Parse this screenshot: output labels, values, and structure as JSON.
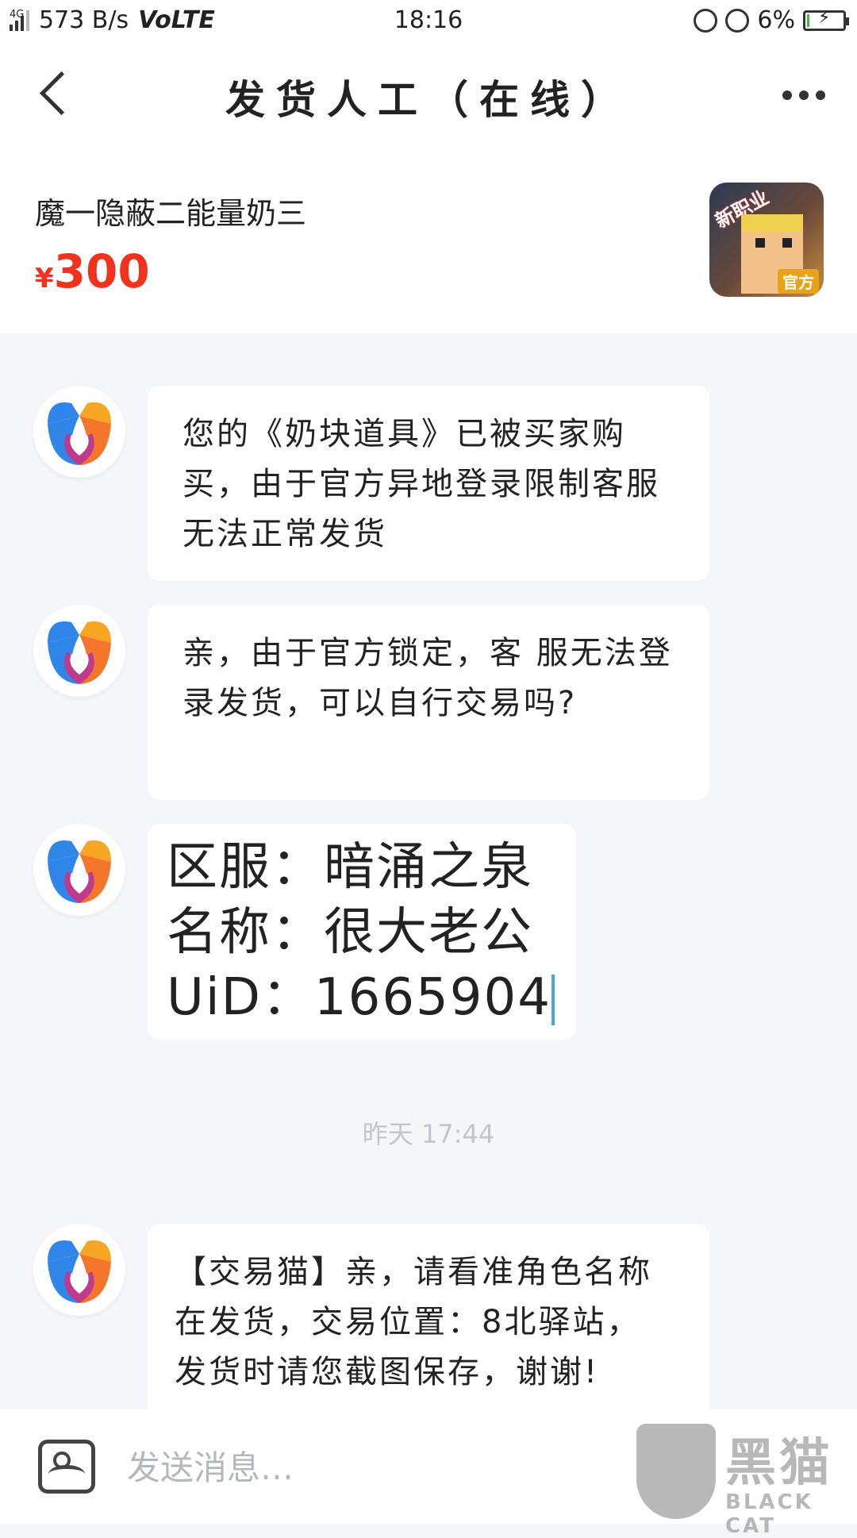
{
  "status_bar": {
    "network_tag": "4G",
    "speed": "573 B/s",
    "volte": "VoLTE",
    "time": "18:16",
    "battery": "6%",
    "battery_level": 0.06
  },
  "header": {
    "title": "发货人工（在线）"
  },
  "product": {
    "name": "魔一隐蔽二能量奶三",
    "currency": "¥",
    "price": "300",
    "image_tag_top": "新职业",
    "image_tag_bottom": "官方"
  },
  "messages": [
    {
      "text": "您的《奶块道具》已被买家购买，由于官方异地登录限制客服无法正常发货"
    },
    {
      "text": "亲，由于官方锁定，客 服无法登录发货，可以自行交易吗?"
    },
    {
      "lines": [
        "区服：暗涌之泉",
        "名称：很大老公",
        "UiD：1665904"
      ]
    },
    {
      "text": "【交易猫】亲，请看准角色名称在发货，交易位置：8北驿站，发货时请您截图保存，谢谢!"
    }
  ],
  "timestamp": "昨天 17:44",
  "input": {
    "placeholder": "发送消息…"
  },
  "watermark": {
    "title": "黑猫",
    "subtitle": "BLACK CAT"
  },
  "colors": {
    "price": "#f0321e",
    "chat_background": "#f5f6fa",
    "caret": "#4aa3e8"
  }
}
